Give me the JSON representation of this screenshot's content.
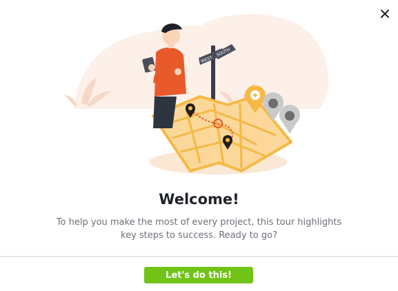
{
  "dialog": {
    "close_icon": "close-icon",
    "title": "Welcome!",
    "description": "To help you make the most of every project, this tour highlights key steps to success. Ready to go?",
    "cta_label": "Let's do this!",
    "accent_color": "#71c416"
  },
  "illustration": {
    "signpost_labels": [
      "WEST",
      "SOUTH"
    ]
  }
}
